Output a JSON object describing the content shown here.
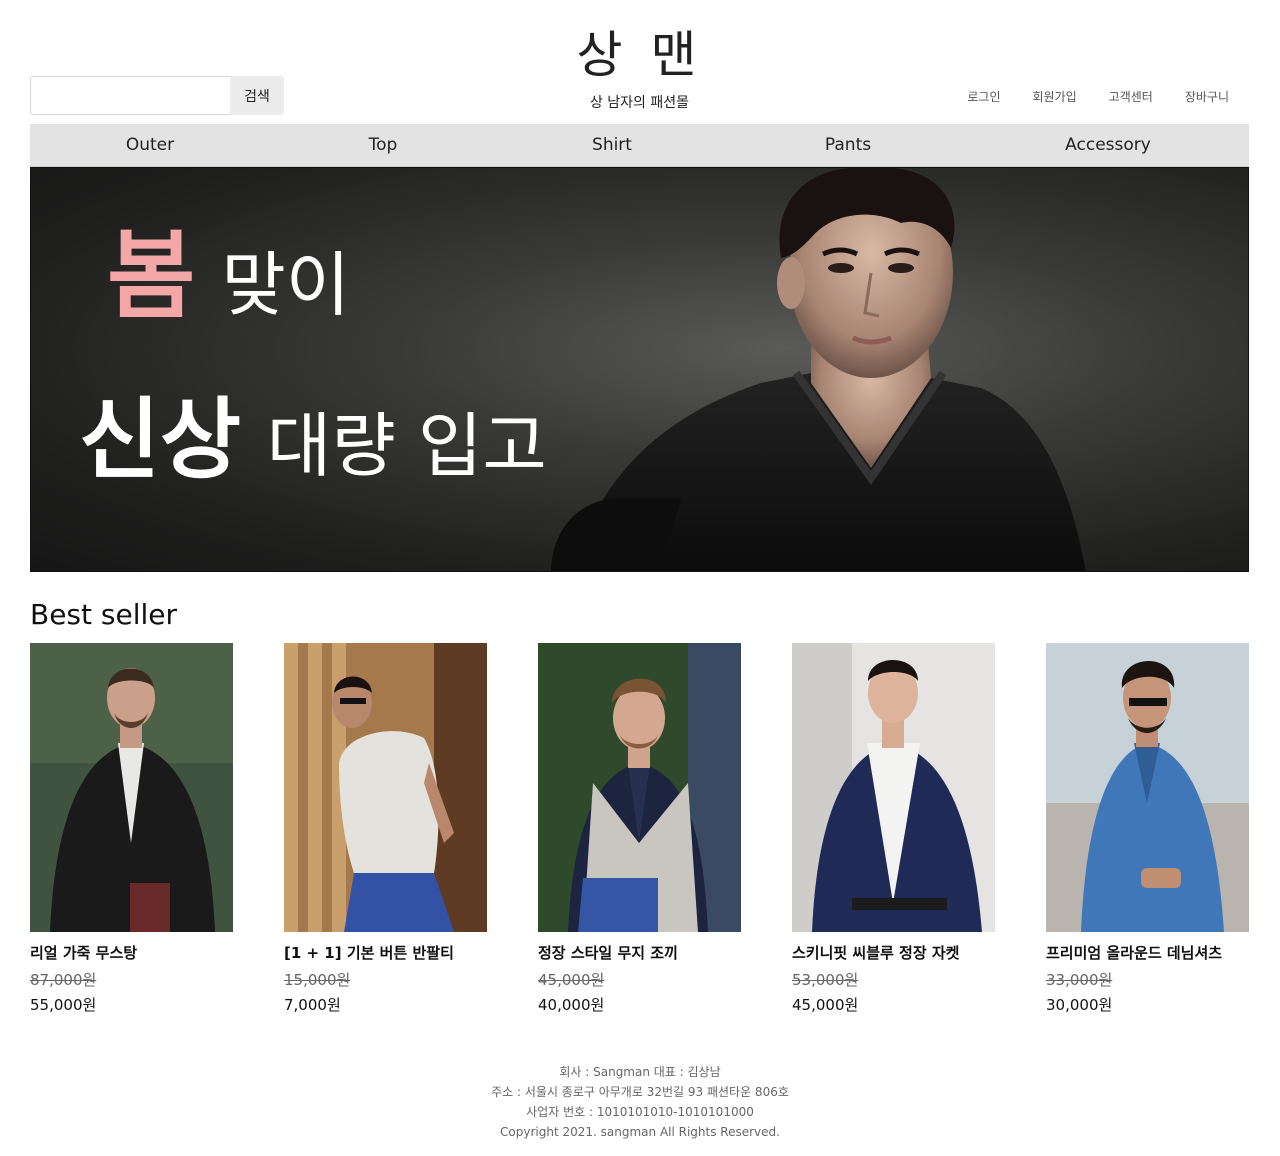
{
  "header": {
    "logo": "상 맨",
    "tagline": "상 남자의 패션몰",
    "search_placeholder": "",
    "search_button": "검색",
    "util_links": [
      "로그인",
      "회원가입",
      "고객센터",
      "장바구니"
    ]
  },
  "nav": {
    "items": [
      "Outer",
      "Top",
      "Shirt",
      "Pants",
      "Accessory"
    ]
  },
  "banner": {
    "line1_accent": "봄",
    "line1_text": "맞이",
    "line2_bold": "신상",
    "line2_text": "대량 입고",
    "accent_color": "#f4a7a7"
  },
  "best_seller": {
    "title": "Best seller",
    "products": [
      {
        "name": "리얼 가죽 무스탕",
        "original_price": "87,000원",
        "price": "55,000원"
      },
      {
        "name": "[1 + 1] 기본 버튼 반팔티",
        "original_price": "15,000원",
        "price": "7,000원"
      },
      {
        "name": "정장 스타일 무지 조끼",
        "original_price": "45,000원",
        "price": "40,000원"
      },
      {
        "name": "스키니핏 씨블루 정장 자켓",
        "original_price": "53,000원",
        "price": "45,000원"
      },
      {
        "name": "프리미엄 올라운드 데님셔츠",
        "original_price": "33,000원",
        "price": "30,000원"
      }
    ]
  },
  "footer": {
    "company": "회사 : Sangman 대표 : 김상남",
    "address": "주소 : 서울시 종로구 아무개로 32번길 93 패션타운 806호",
    "business_no": "사업자 번호 : 1010101010-1010101000",
    "copyright": "Copyright 2021. sangman All Rights Reserved."
  }
}
